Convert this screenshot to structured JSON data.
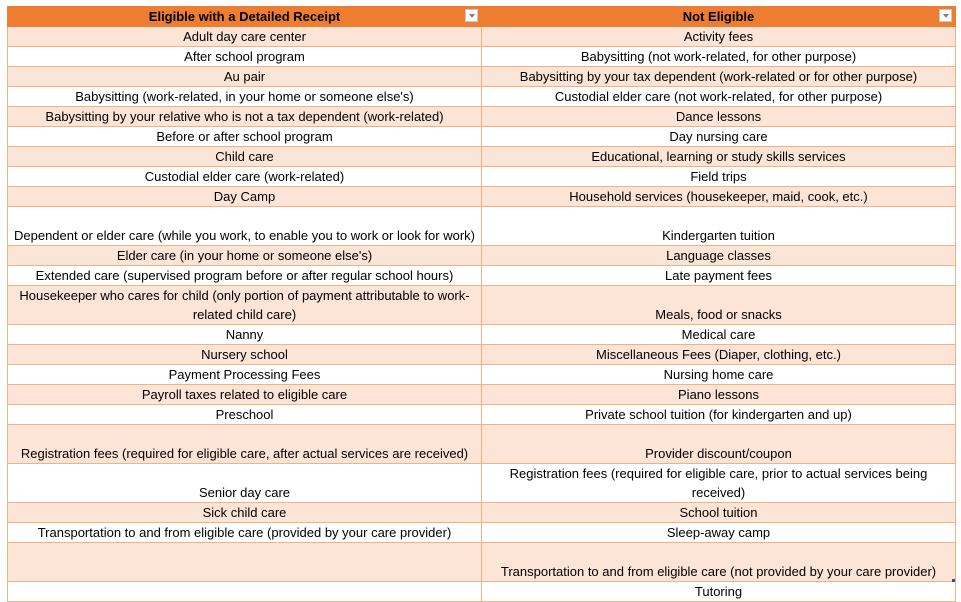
{
  "headers": [
    "Eligible with a Detailed Receipt",
    "Not Eligible"
  ],
  "rows": [
    [
      "Adult day care center",
      "Activity fees"
    ],
    [
      "After school program",
      "Babysitting (not work-related, for other purpose)"
    ],
    [
      "Au pair",
      "Babysitting by your tax dependent (work-related or for other purpose)"
    ],
    [
      "Babysitting (work-related, in your home or someone else's)",
      "Custodial elder care (not work-related, for other purpose)"
    ],
    [
      "Babysitting by your relative who is not a tax dependent (work-related)",
      "Dance lessons"
    ],
    [
      "Before or after school program",
      "Day nursing care"
    ],
    [
      "Child care",
      "Educational, learning or study skills services"
    ],
    [
      "Custodial elder care (work-related)",
      "Field trips"
    ],
    [
      "Day Camp",
      "Household services (housekeeper, maid, cook, etc.)"
    ],
    [
      "Dependent or elder care (while you work, to enable you to work or look for work)",
      "Kindergarten tuition"
    ],
    [
      "Elder care (in your home or someone else's)",
      "Language classes"
    ],
    [
      "Extended care (supervised program before or after regular school hours)",
      "Late payment fees"
    ],
    [
      "Housekeeper who cares for child (only portion of payment attributable to work-related child care)",
      "Meals, food or snacks"
    ],
    [
      "Nanny",
      "Medical care"
    ],
    [
      "Nursery school",
      "Miscellaneous Fees (Diaper, clothing, etc.)"
    ],
    [
      "Payment Processing Fees",
      "Nursing home care"
    ],
    [
      "Payroll taxes related to eligible care",
      "Piano lessons"
    ],
    [
      "Preschool",
      "Private school tuition (for kindergarten and up)"
    ],
    [
      "Registration fees (required for eligible care, after actual services are received)",
      "Provider discount/coupon"
    ],
    [
      "Senior day care",
      "Registration fees (required for eligible care, prior to actual services being received)"
    ],
    [
      "Sick child care",
      "School tuition"
    ],
    [
      "Transportation to and from eligible care (provided by your care provider)",
      "Sleep-away camp"
    ],
    [
      "",
      "Transportation to and from eligible care (not provided by your care provider)"
    ],
    [
      "",
      "Tutoring"
    ]
  ],
  "colors": {
    "header": "#ed7d31",
    "band": "#fce4d6",
    "border": "#f4b183"
  }
}
